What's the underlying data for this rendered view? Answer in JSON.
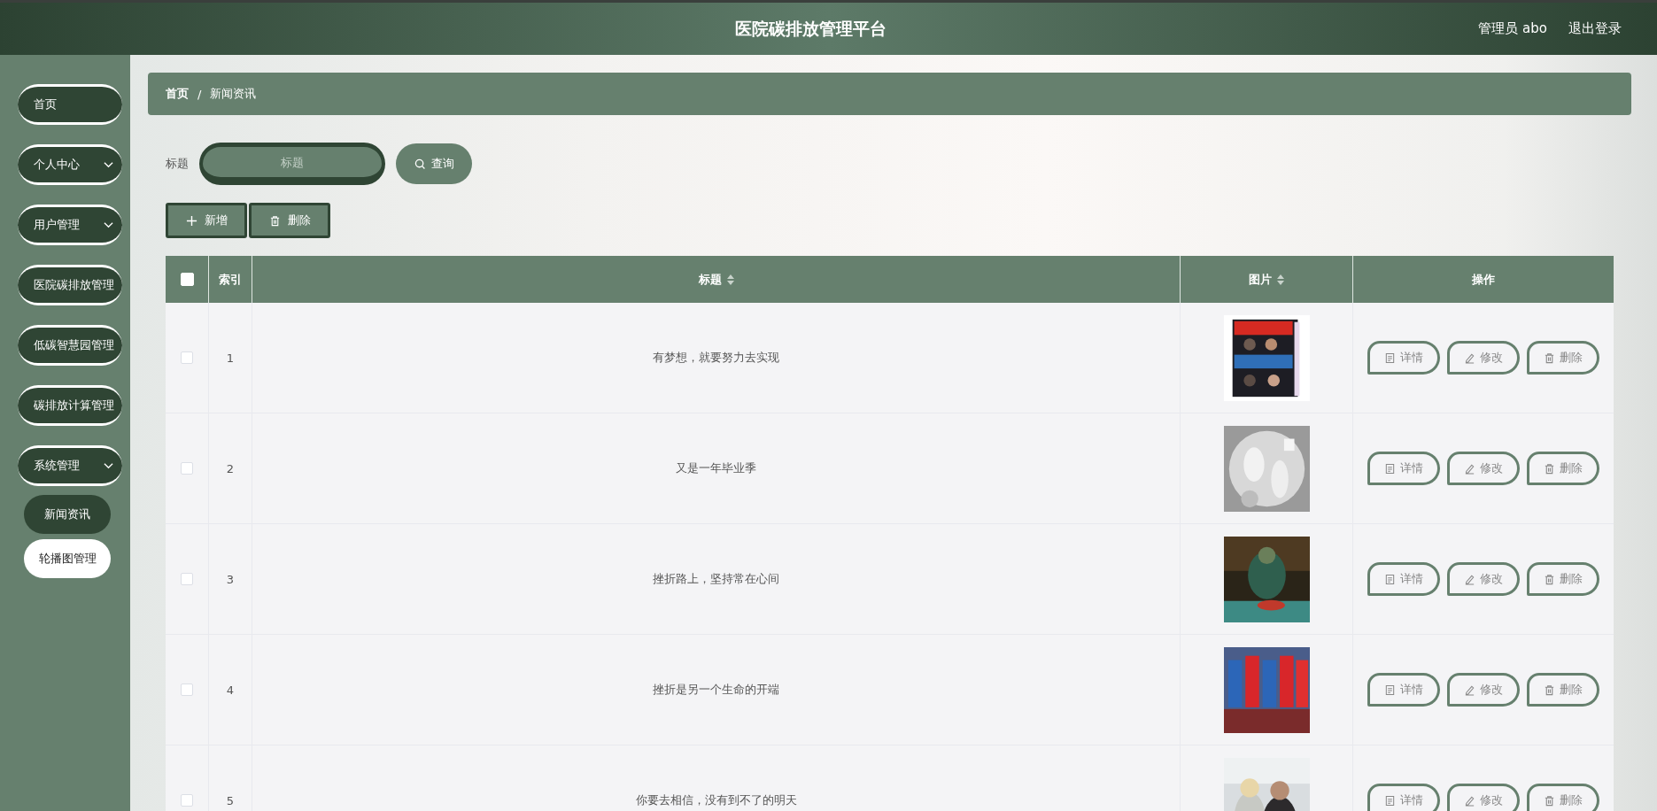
{
  "header": {
    "title": "医院碳排放管理平台",
    "user": "管理员 abo",
    "logout": "退出登录"
  },
  "sidebar": {
    "items": [
      {
        "label": "首页",
        "expandable": false
      },
      {
        "label": "个人中心",
        "expandable": true
      },
      {
        "label": "用户管理",
        "expandable": true
      },
      {
        "label": "医院碳排放管理",
        "expandable": false
      },
      {
        "label": "低碳智慧园管理",
        "expandable": false
      },
      {
        "label": "碳排放计算管理",
        "expandable": false
      },
      {
        "label": "系统管理",
        "expandable": true,
        "children": [
          {
            "label": "新闻资讯",
            "selected": false
          },
          {
            "label": "轮播图管理",
            "selected": true
          }
        ]
      }
    ]
  },
  "breadcrumb": {
    "separator": "/",
    "items": [
      "首页",
      "新闻资讯"
    ]
  },
  "search": {
    "label": "标题",
    "placeholder": "标题",
    "button": "查询"
  },
  "actions": [
    {
      "kind": "add",
      "label": "新增"
    },
    {
      "kind": "delete",
      "label": "删除"
    }
  ],
  "table": {
    "all_checked": false,
    "columns": [
      {
        "label": "索引",
        "sortable": false
      },
      {
        "label": "标题",
        "sortable": true
      },
      {
        "label": "图片",
        "sortable": true
      },
      {
        "label": "操作",
        "sortable": false
      }
    ],
    "rows": [
      {
        "checked": false,
        "index": "1",
        "title": "有梦想，就要努力去实现",
        "image": {
          "kind": "picture"
        },
        "buttons": [
          {
            "kind": "detail",
            "label": "详情"
          },
          {
            "kind": "edit",
            "label": "修改"
          },
          {
            "kind": "delete",
            "label": "删除"
          }
        ]
      },
      {
        "checked": false,
        "index": "2",
        "title": "又是一年毕业季",
        "image": {
          "kind": "picture"
        },
        "buttons": [
          {
            "kind": "detail",
            "label": "详情"
          },
          {
            "kind": "edit",
            "label": "修改"
          },
          {
            "kind": "delete",
            "label": "删除"
          }
        ]
      },
      {
        "checked": false,
        "index": "3",
        "title": "挫折路上，坚持常在心间",
        "image": {
          "kind": "picture"
        },
        "buttons": [
          {
            "kind": "detail",
            "label": "详情"
          },
          {
            "kind": "edit",
            "label": "修改"
          },
          {
            "kind": "delete",
            "label": "删除"
          }
        ]
      },
      {
        "checked": false,
        "index": "4",
        "title": "挫折是另一个生命的开端",
        "image": {
          "kind": "picture"
        },
        "buttons": [
          {
            "kind": "detail",
            "label": "详情"
          },
          {
            "kind": "edit",
            "label": "修改"
          },
          {
            "kind": "delete",
            "label": "删除"
          }
        ]
      },
      {
        "checked": false,
        "index": "5",
        "title": "你要去相信，没有到不了的明天",
        "image": {
          "kind": "picture"
        },
        "buttons": [
          {
            "kind": "detail",
            "label": "详情"
          },
          {
            "kind": "edit",
            "label": "修改"
          },
          {
            "kind": "delete",
            "label": "删除"
          }
        ]
      }
    ]
  }
}
